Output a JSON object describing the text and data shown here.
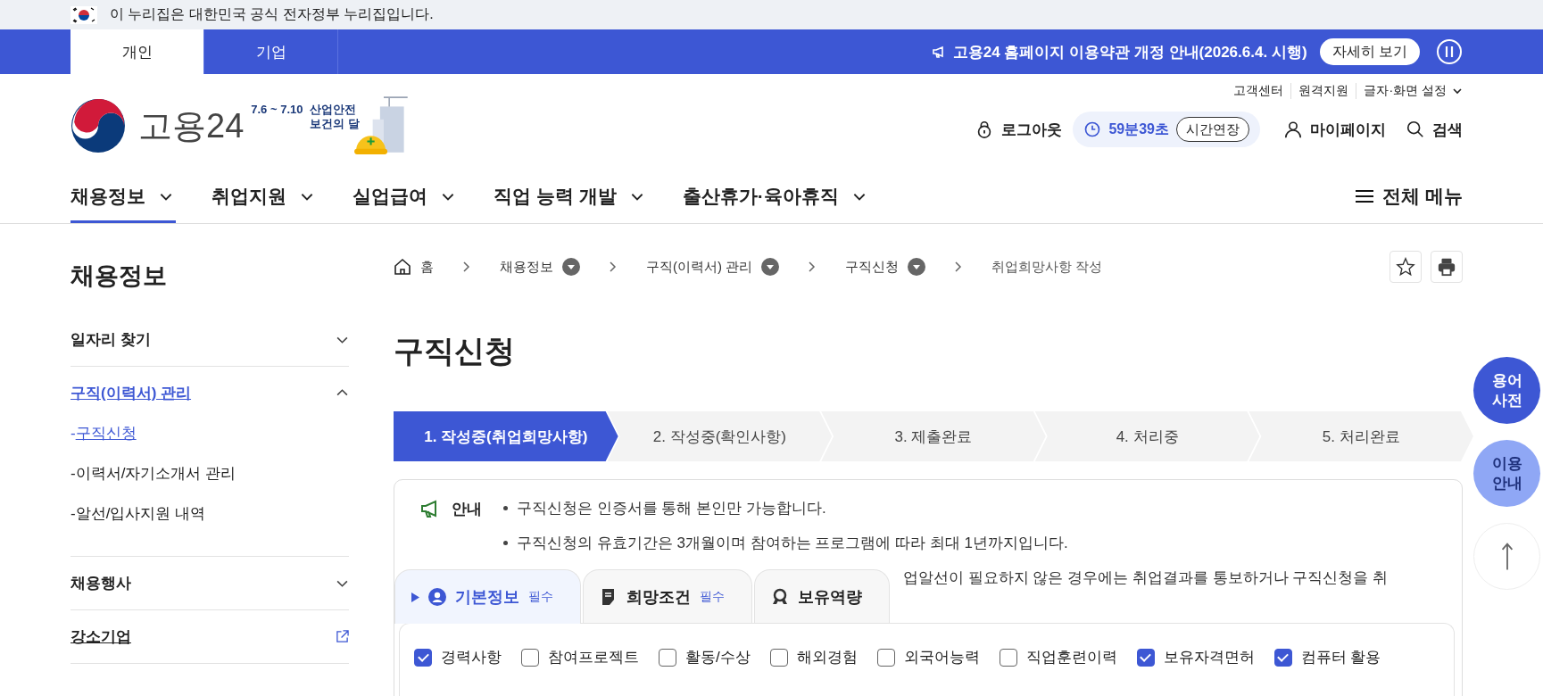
{
  "gov_banner": {
    "text": "이 누리집은 대한민국 공식 전자정부 누리집입니다."
  },
  "audience_tabs": [
    {
      "label": "개인",
      "selected": true
    },
    {
      "label": "기업",
      "selected": false
    }
  ],
  "announcement": {
    "text": "고용24 홈페이지 이용약관 개정 안내(2026.6.4. 시행)",
    "button": "자세히 보기"
  },
  "logo": {
    "text": "고용24",
    "campaign_date": "7.6 ~ 7.10",
    "campaign_lines": [
      "산업안전",
      "보건의 달"
    ]
  },
  "utility_links": [
    "고객센터",
    "원격지원",
    "글자·화면 설정"
  ],
  "user_bar": {
    "logout": "로그아웃",
    "timer": "59분39초",
    "extend": "시간연장",
    "mypage": "마이페이지",
    "search": "검색"
  },
  "main_nav": [
    {
      "label": "채용정보",
      "selected": true
    },
    {
      "label": "취업지원",
      "selected": false
    },
    {
      "label": "실업급여",
      "selected": false
    },
    {
      "label": "직업 능력 개발",
      "selected": false
    },
    {
      "label": "출산휴가·육아휴직",
      "selected": false
    }
  ],
  "all_menu": "전체 메뉴",
  "sidebar": {
    "title": "채용정보",
    "items": [
      {
        "label": "일자리 찾기",
        "kind": "group",
        "expanded": false,
        "selected": false
      },
      {
        "label": "구직(이력서) 관리",
        "kind": "group",
        "expanded": true,
        "selected": true,
        "children": [
          {
            "marker": "-",
            "label": "구직신청",
            "selected": true
          },
          {
            "marker": "-",
            "label": "이력서/자기소개서 관리",
            "selected": false
          },
          {
            "marker": "-",
            "label": "알선/입사지원 내역",
            "selected": false
          }
        ]
      },
      {
        "label": "채용행사",
        "kind": "group",
        "expanded": false,
        "selected": false
      },
      {
        "label": "강소기업",
        "kind": "external",
        "selected": false
      }
    ]
  },
  "breadcrumb": [
    {
      "label": "홈",
      "kind": "home"
    },
    {
      "label": "채용정보",
      "kind": "menu"
    },
    {
      "label": "구직(이력서) 관리",
      "kind": "menu"
    },
    {
      "label": "구직신청",
      "kind": "menu"
    },
    {
      "label": "취업희망사항 작성",
      "kind": "current"
    }
  ],
  "page_title": "구직신청",
  "steps": [
    {
      "label": "1. 작성중(취업희망사항)",
      "selected": true
    },
    {
      "label": "2. 작성중(확인사항)",
      "selected": false
    },
    {
      "label": "3. 제출완료",
      "selected": false
    },
    {
      "label": "4. 처리중",
      "selected": false
    },
    {
      "label": "5. 처리완료",
      "selected": false
    }
  ],
  "notice": {
    "label": "안내",
    "lines": [
      "구직신청은 인증서를 통해 본인만 가능합니다.",
      "구직신청의 유효기간은 3개월이며 참여하는 프로그램에 따라 최대 1년까지입니다."
    ],
    "partial_line": "업알선이 필요하지 않은 경우에는 취업결과를 통보하거나 구직신청을 취"
  },
  "form_tabs": [
    {
      "label": "기본정보",
      "badge": "필수",
      "selected": true
    },
    {
      "label": "희망조건",
      "badge": "필수",
      "selected": false
    },
    {
      "label": "보유역량",
      "selected": false
    }
  ],
  "sections": [
    {
      "label": "경력사항",
      "checked": true
    },
    {
      "label": "참여프로젝트",
      "checked": false
    },
    {
      "label": "활동/수상",
      "checked": false
    },
    {
      "label": "해외경험",
      "checked": false
    },
    {
      "label": "외국어능력",
      "checked": false
    },
    {
      "label": "직업훈련이력",
      "checked": false
    },
    {
      "label": "보유자격면허",
      "checked": true
    },
    {
      "label": "컴퓨터 활용",
      "checked": true
    }
  ],
  "side_buttons": [
    {
      "label": "용어 사전",
      "kind": "dictionary"
    },
    {
      "label": "이용 안내",
      "kind": "guide"
    },
    {
      "kind": "top"
    }
  ]
}
